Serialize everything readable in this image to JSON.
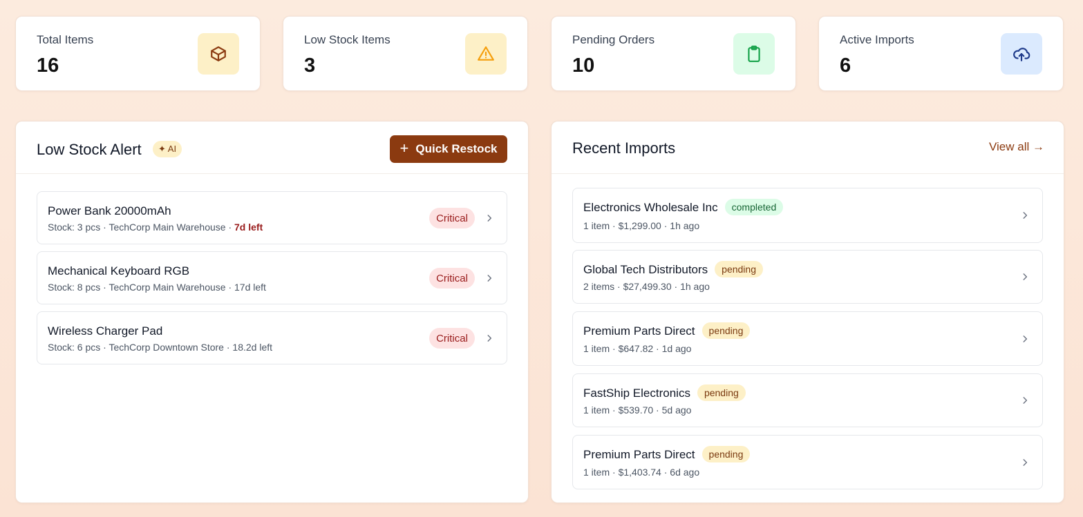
{
  "stats": [
    {
      "label": "Total Items",
      "value": "16",
      "icon": "box-icon",
      "bg": "#fdf0c7",
      "color": "#8b3a10"
    },
    {
      "label": "Low Stock Items",
      "value": "3",
      "icon": "warning-icon",
      "bg": "#fdf0c7",
      "color": "#f59e0b"
    },
    {
      "label": "Pending Orders",
      "value": "10",
      "icon": "clipboard-icon",
      "bg": "#dcfce7",
      "color": "#16a34a"
    },
    {
      "label": "Active Imports",
      "value": "6",
      "icon": "cloud-upload-icon",
      "bg": "#dbeafe",
      "color": "#1e3a8a"
    }
  ],
  "low_stock": {
    "title": "Low Stock Alert",
    "ai_badge": "✦ AI",
    "restock_label": "Quick Restock",
    "restock_icon": "+",
    "items": [
      {
        "name": "Power Bank 20000mAh",
        "meta": "Stock: 3 pcs · TechCorp Main Warehouse · ",
        "days": "7d left",
        "days_urgent": true,
        "badge": "Critical"
      },
      {
        "name": "Mechanical Keyboard RGB",
        "meta": "Stock: 8 pcs · TechCorp Main Warehouse · ",
        "days": "17d left",
        "days_urgent": false,
        "badge": "Critical"
      },
      {
        "name": "Wireless Charger Pad",
        "meta": "Stock: 6 pcs · TechCorp Downtown Store · ",
        "days": "18.2d left",
        "days_urgent": false,
        "badge": "Critical"
      }
    ]
  },
  "recent_imports": {
    "title": "Recent Imports",
    "view_all": "View all →",
    "items": [
      {
        "supplier": "Electronics Wholesale Inc",
        "status": "completed",
        "meta": "1 item · $1,299.00 · 1h ago"
      },
      {
        "supplier": "Global Tech Distributors",
        "status": "pending",
        "meta": "2 items · $27,499.30 · 1h ago"
      },
      {
        "supplier": "Premium Parts Direct",
        "status": "pending",
        "meta": "1 item · $647.82 · 1d ago"
      },
      {
        "supplier": "FastShip Electronics",
        "status": "pending",
        "meta": "1 item · $539.70 · 5d ago"
      },
      {
        "supplier": "Premium Parts Direct",
        "status": "pending",
        "meta": "1 item · $1,403.74 · 6d ago"
      }
    ]
  },
  "colors": {
    "accent": "#8b3a10",
    "critical_bg": "#fde2e2",
    "critical_text": "#991b1b",
    "completed_bg": "#dcfce7",
    "pending_bg": "#fdf0c7"
  }
}
